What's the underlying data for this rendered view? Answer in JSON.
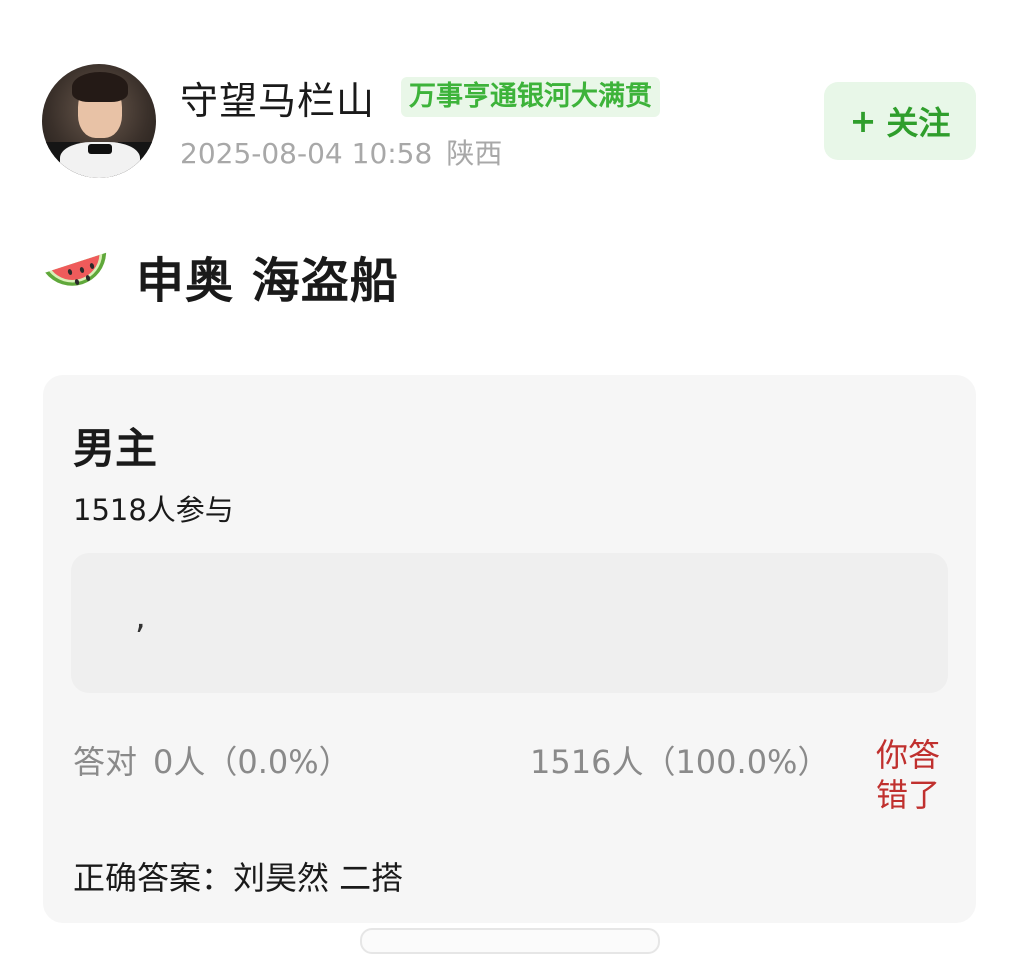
{
  "header": {
    "username": "守望马栏山",
    "badge": "万事亨通银河大满贯",
    "timestamp": "2025-08-04 10:58",
    "location": "陕西",
    "follow_plus": "+",
    "follow_label": "关注",
    "accent_color": "#3db33a"
  },
  "post": {
    "title_icon": "watermelon-icon",
    "title": "申奥 海盗船"
  },
  "quiz": {
    "question": "男主",
    "participants": "1518人参与",
    "answer_text": ",",
    "correct_label": "答对",
    "correct_count": "0人（0.0%）",
    "other_count": "1516人（100.0%）",
    "result": "你答错了",
    "result_color": "#c0302e",
    "correct_answer": "正确答案：刘昊然 二搭"
  }
}
